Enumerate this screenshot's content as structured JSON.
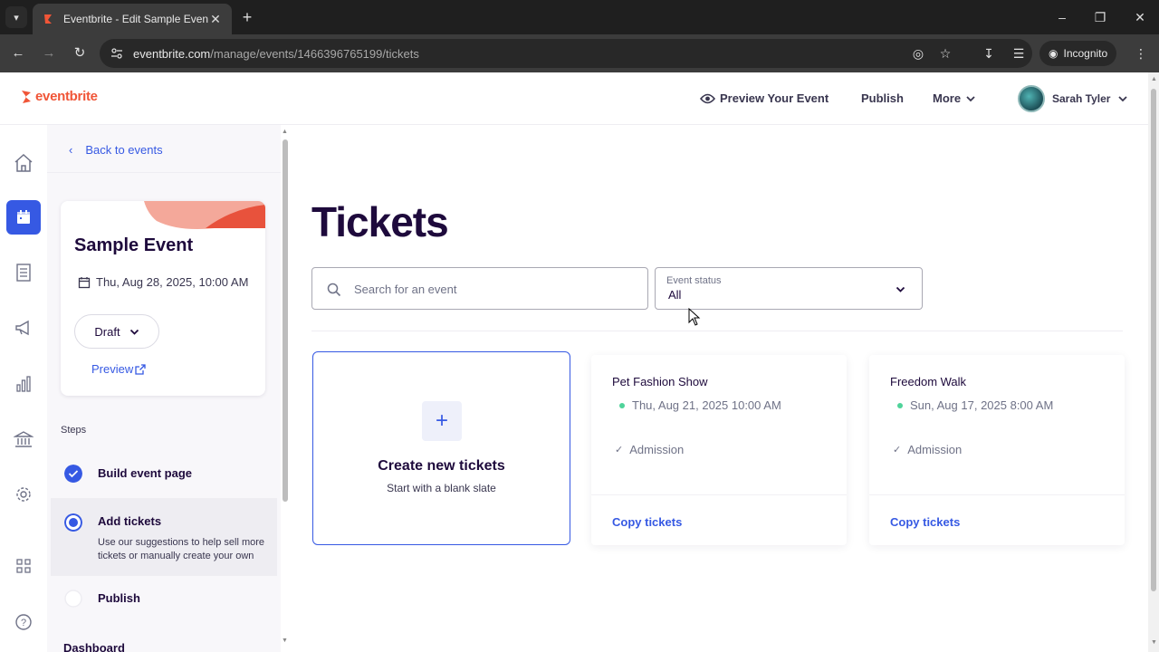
{
  "browser": {
    "tab_title": "Eventbrite - Edit Sample Event",
    "url_host": "eventbrite.com",
    "url_path": "/manage/events/1466396765199/tickets",
    "incognito_label": "Incognito"
  },
  "header": {
    "logo": "eventbrite",
    "preview_label": "Preview Your Event",
    "publish_label": "Publish",
    "more_label": "More",
    "user_name": "Sarah Tyler"
  },
  "colors": {
    "brand_orange": "#f05537",
    "accent_blue": "#3659e3",
    "text_dark": "#1e0a3c"
  },
  "rail": {
    "items": [
      "home-icon",
      "calendar-icon",
      "orders-icon",
      "megaphone-icon",
      "reports-icon",
      "finance-icon",
      "settings-icon",
      "apps-icon",
      "help-icon"
    ],
    "active_index": 1
  },
  "panel": {
    "back_label": "Back to events",
    "event_name": "Sample Event",
    "event_date": "Thu, Aug 28, 2025, 10:00 AM",
    "status_label": "Draft",
    "preview_label": "Preview",
    "steps_label": "Steps",
    "steps": [
      {
        "title": "Build event page",
        "state": "done"
      },
      {
        "title": "Add tickets",
        "state": "current",
        "desc": "Use our suggestions to help sell more tickets or manually create your own"
      },
      {
        "title": "Publish",
        "state": "todo"
      }
    ],
    "next_section": "Dashboard"
  },
  "main": {
    "title": "Tickets",
    "search_placeholder": "Search for an event",
    "status_filter_label": "Event status",
    "status_filter_value": "All",
    "create_card": {
      "title": "Create new tickets",
      "subtitle": "Start with a blank slate"
    },
    "events": [
      {
        "name": "Pet Fashion Show",
        "date": "Thu, Aug 21, 2025 10:00 AM",
        "ticket": "Admission",
        "action": "Copy tickets"
      },
      {
        "name": "Freedom Walk",
        "date": "Sun, Aug 17, 2025 8:00 AM",
        "ticket": "Admission",
        "action": "Copy tickets"
      }
    ]
  }
}
